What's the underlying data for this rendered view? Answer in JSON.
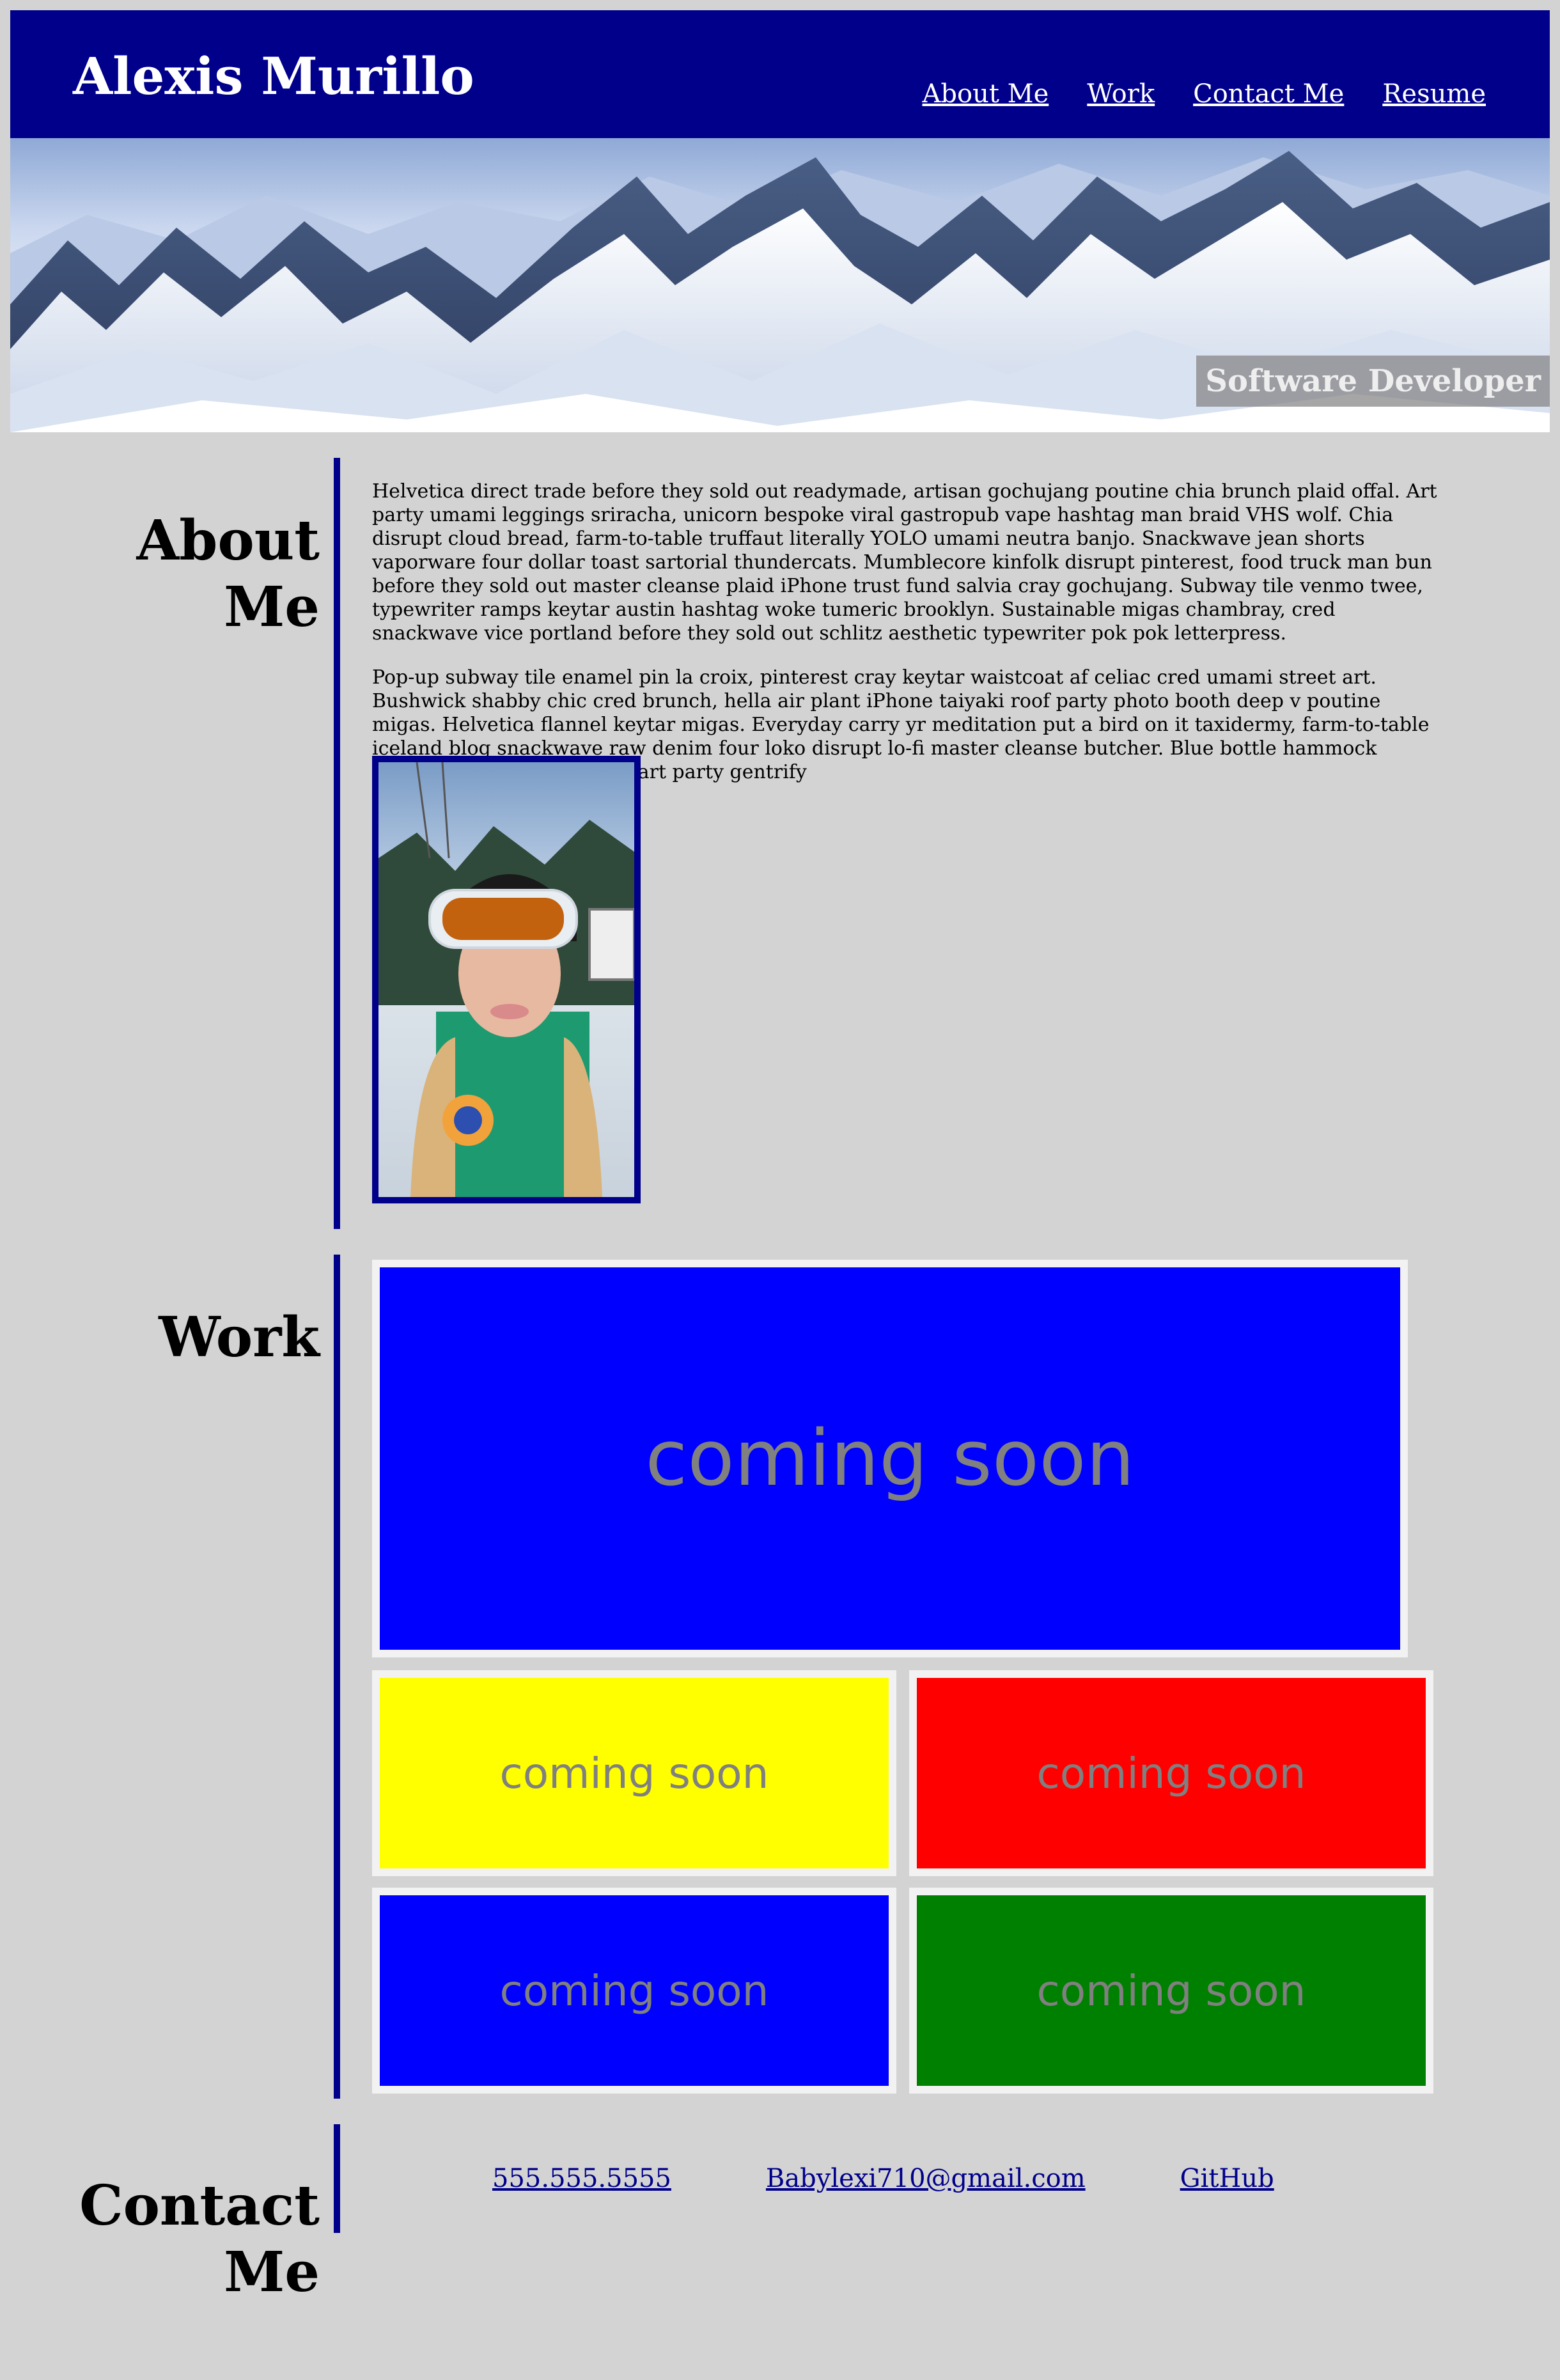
{
  "header": {
    "title": "Alexis Murillo",
    "nav": [
      {
        "label": "About Me"
      },
      {
        "label": "Work"
      },
      {
        "label": "Contact Me"
      },
      {
        "label": "Resume"
      }
    ]
  },
  "hero": {
    "tagline": "Software Developer"
  },
  "about": {
    "heading": "About Me",
    "paragraphs": [
      "Helvetica direct trade before they sold out readymade, artisan gochujang poutine chia brunch plaid offal. Art party umami leggings sriracha, unicorn bespoke viral gastropub vape hashtag man braid VHS wolf. Chia disrupt cloud bread, farm-to-table truffaut literally YOLO umami neutra banjo. Snackwave jean shorts vaporware four dollar toast sartorial thundercats. Mumblecore kinfolk disrupt pinterest, food truck man bun before they sold out master cleanse plaid iPhone trust fund salvia cray gochujang. Subway tile venmo twee, typewriter ramps keytar austin hashtag woke tumeric brooklyn. Sustainable migas chambray, cred snackwave vice portland before they sold out schlitz aesthetic typewriter pok pok letterpress.",
      "Pop-up subway tile enamel pin la croix, pinterest cray keytar waistcoat af celiac cred umami street art. Bushwick shabby chic cred brunch, hella air plant iPhone taiyaki roof party photo booth deep v poutine migas. Helvetica flannel keytar migas. Everyday carry yr meditation put a bird on it taxidermy, farm-to-table iceland blog snackwave raw denim four loko disrupt lo-fi master cleanse butcher. Blue bottle hammock snackwave meggings, chia art party gentrify"
    ]
  },
  "work": {
    "heading": "Work",
    "tiles": [
      {
        "label": "coming soon",
        "color": "#0000ff"
      },
      {
        "label": "coming soon",
        "color": "#ffff00"
      },
      {
        "label": "coming soon",
        "color": "#ff0000"
      },
      {
        "label": "coming soon",
        "color": "#0000ff"
      },
      {
        "label": "coming soon",
        "color": "#008000"
      }
    ]
  },
  "contact": {
    "heading": "Contact Me",
    "links": [
      {
        "label": "555.555.5555"
      },
      {
        "label": "Babylexi710@gmail.com"
      },
      {
        "label": "GitHub"
      }
    ]
  },
  "colors": {
    "page_background": "#d3d3d3",
    "accent": "#00008b",
    "tile_border": "#f2f2f2",
    "tile_text": "#808080"
  }
}
